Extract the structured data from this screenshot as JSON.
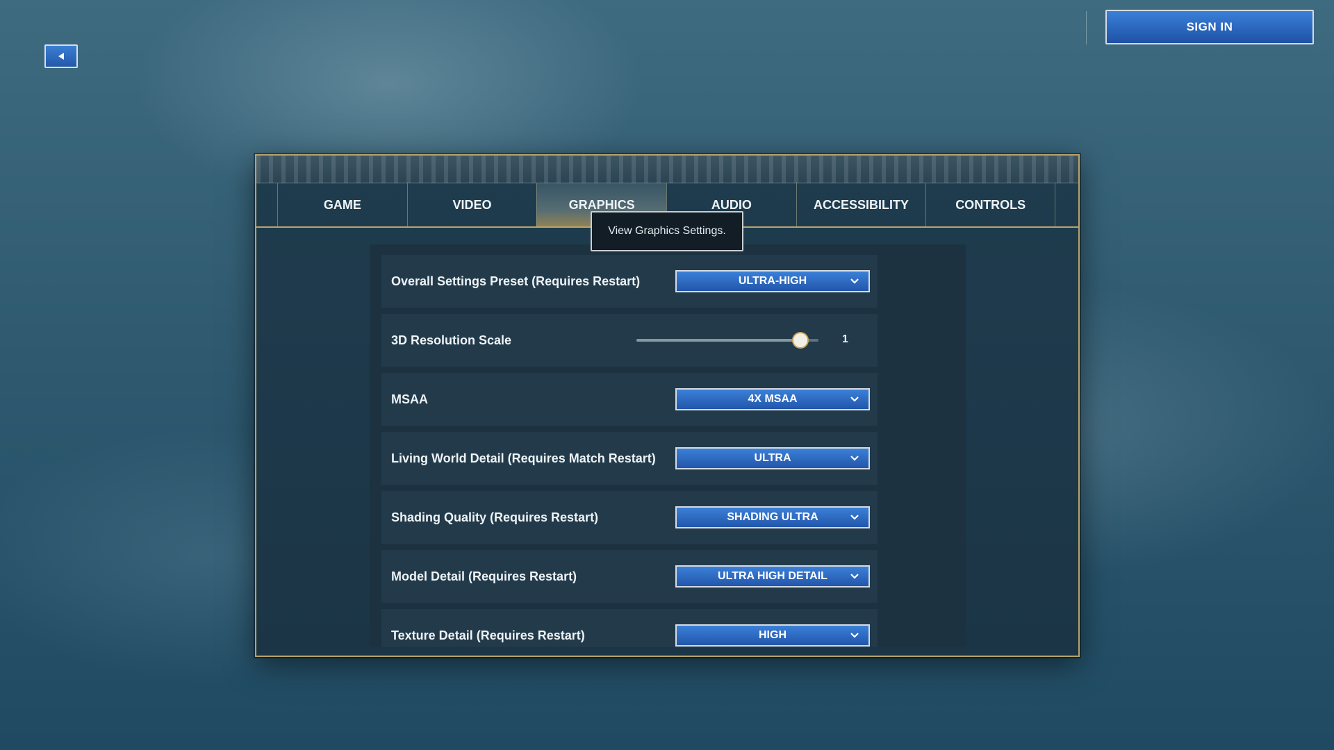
{
  "topbar": {
    "back_icon": "back-arrow-icon",
    "signin_label": "SIGN IN"
  },
  "tabs": [
    {
      "label": "GAME",
      "active": false
    },
    {
      "label": "VIDEO",
      "active": false
    },
    {
      "label": "GRAPHICS",
      "active": true
    },
    {
      "label": "AUDIO",
      "active": false
    },
    {
      "label": "ACCESSIBILITY",
      "active": false
    },
    {
      "label": "CONTROLS",
      "active": false
    }
  ],
  "tooltip": "View Graphics Settings.",
  "settings": {
    "overall_preset": {
      "label": "Overall Settings Preset (Requires Restart)",
      "value": "ULTRA-HIGH"
    },
    "resolution_scale": {
      "label": "3D Resolution Scale",
      "value": "1",
      "fraction": 0.9
    },
    "msaa": {
      "label": "MSAA",
      "value": "4X MSAA"
    },
    "living_world": {
      "label": "Living World Detail (Requires Match Restart)",
      "value": "ULTRA"
    },
    "shading": {
      "label": "Shading Quality (Requires Restart)",
      "value": "SHADING ULTRA"
    },
    "model_detail": {
      "label": "Model Detail (Requires Restart)",
      "value": "ULTRA HIGH DETAIL"
    },
    "texture_detail": {
      "label": "Texture Detail (Requires Restart)",
      "value": "HIGH"
    }
  },
  "colors": {
    "button_blue": "#2f6cc4",
    "gold_trim": "#b8a46a",
    "panel_bg": "#1f3c4e"
  }
}
